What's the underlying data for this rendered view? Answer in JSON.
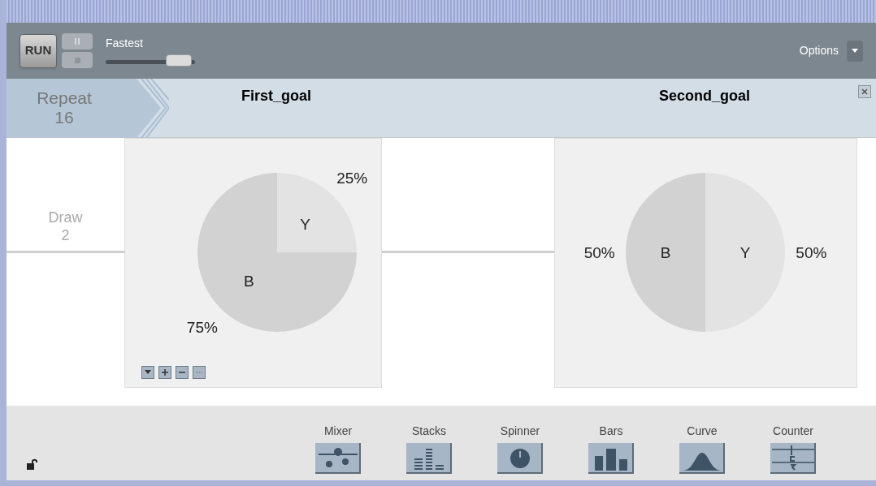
{
  "toolbar": {
    "run": "RUN",
    "speed_label": "Fastest",
    "speed": {
      "level": 0.82
    },
    "options": "Options"
  },
  "repeat": {
    "label": "Repeat",
    "count": "16"
  },
  "draw": {
    "label": "Draw",
    "count": "2"
  },
  "devices": [
    {
      "title": "First_goal",
      "controls": true,
      "chart_data": {
        "type": "pie",
        "categories": [
          "Y",
          "B"
        ],
        "values": [
          25,
          75
        ],
        "value_labels": [
          "25%",
          "75%"
        ]
      }
    },
    {
      "title": "Second_goal",
      "controls": false,
      "chart_data": {
        "type": "pie",
        "categories": [
          "Y",
          "B"
        ],
        "values": [
          50,
          50
        ],
        "value_labels": [
          "50%",
          "50%"
        ]
      }
    }
  ],
  "tools": [
    {
      "label": "Mixer",
      "kind": "mixer"
    },
    {
      "label": "Stacks",
      "kind": "stacks"
    },
    {
      "label": "Spinner",
      "kind": "spinner"
    },
    {
      "label": "Bars",
      "kind": "bars"
    },
    {
      "label": "Curve",
      "kind": "curve"
    },
    {
      "label": "Counter",
      "kind": "counter"
    }
  ]
}
